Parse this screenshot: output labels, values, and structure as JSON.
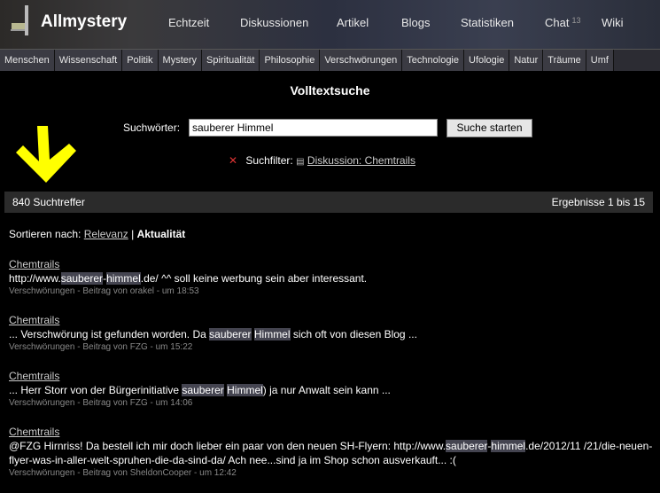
{
  "header": {
    "logo": "Allmystery",
    "nav": [
      "Echtzeit",
      "Diskussionen",
      "Artikel",
      "Blogs",
      "Statistiken",
      "Chat",
      "Wiki"
    ],
    "chat_count": "13"
  },
  "categories": [
    "Menschen",
    "Wissenschaft",
    "Politik",
    "Mystery",
    "Spiritualität",
    "Philosophie",
    "Verschwörungen",
    "Technologie",
    "Ufologie",
    "Natur",
    "Träume",
    "Umf"
  ],
  "page_title": "Volltextsuche",
  "search": {
    "label": "Suchwörter:",
    "value": "sauberer Himmel",
    "button": "Suche starten"
  },
  "filter": {
    "remove_icon": "x-icon",
    "label": "Suchfilter:",
    "value": "Diskussion: Chemtrails"
  },
  "summary": {
    "count": "840 Suchtreffer",
    "range": "Ergebnisse 1 bis 15"
  },
  "sort": {
    "label": "Sortieren nach:",
    "option_relevance": "Relevanz",
    "option_current": "Aktualität"
  },
  "annotation": {
    "arrow_color": "#ffff00"
  },
  "highlight_color": "#444450",
  "results": [
    {
      "title": "Chemtrails",
      "parts": [
        [
          "http://www.",
          0
        ],
        [
          "sauberer",
          1
        ],
        [
          "-",
          0
        ],
        [
          "himmel",
          1
        ],
        [
          ".de/ ^^ soll keine werbung sein aber interessant.",
          0
        ]
      ],
      "meta": "Verschwörungen - Beitrag von orakel - um 18:53"
    },
    {
      "title": "Chemtrails",
      "parts": [
        [
          "... Verschwörung ist gefunden worden. Da ",
          0
        ],
        [
          "sauberer",
          1
        ],
        [
          " ",
          0
        ],
        [
          "Himmel",
          1
        ],
        [
          " sich oft von diesen Blog ...",
          0
        ]
      ],
      "meta": "Verschwörungen - Beitrag von FZG - um 15:22"
    },
    {
      "title": "Chemtrails",
      "parts": [
        [
          "... Herr Storr von der Bürgerinitiative ",
          0
        ],
        [
          "sauberer",
          1
        ],
        [
          " ",
          0
        ],
        [
          "Himmel",
          1
        ],
        [
          ") ja nur Anwalt sein kann ...",
          0
        ]
      ],
      "meta": "Verschwörungen - Beitrag von FZG - um 14:06"
    },
    {
      "title": "Chemtrails",
      "parts": [
        [
          "@FZG Hirnriss! Da bestell ich mir doch lieber ein paar von den neuen SH-Flyern: http://www.",
          0
        ],
        [
          "sauberer",
          1
        ],
        [
          "-",
          0
        ],
        [
          "himmel",
          1
        ],
        [
          ".de/2012/11 /21/die-neuen-flyer-was-in-aller-welt-spruhen-die-da-sind-da/ Ach nee...sind ja im Shop schon ausverkauft... :(",
          0
        ]
      ],
      "meta": "Verschwörungen - Beitrag von SheldonCooper - um 12:42"
    }
  ]
}
